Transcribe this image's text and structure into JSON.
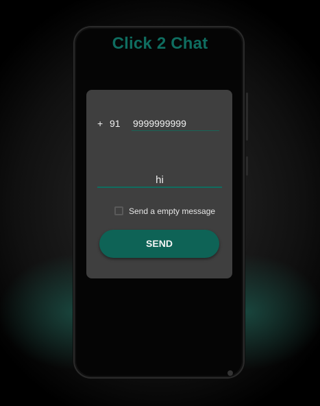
{
  "app": {
    "title": "Click 2 Chat"
  },
  "form": {
    "plus_sign": "+",
    "country_code": "91",
    "phone_number": "9999999999",
    "message": "hi",
    "empty_message_label": "Send a empty message",
    "empty_message_checked": false,
    "send_label": "SEND"
  },
  "colors": {
    "accent": "#0f6d60",
    "card": "#3f3f3f",
    "background": "#000000"
  }
}
